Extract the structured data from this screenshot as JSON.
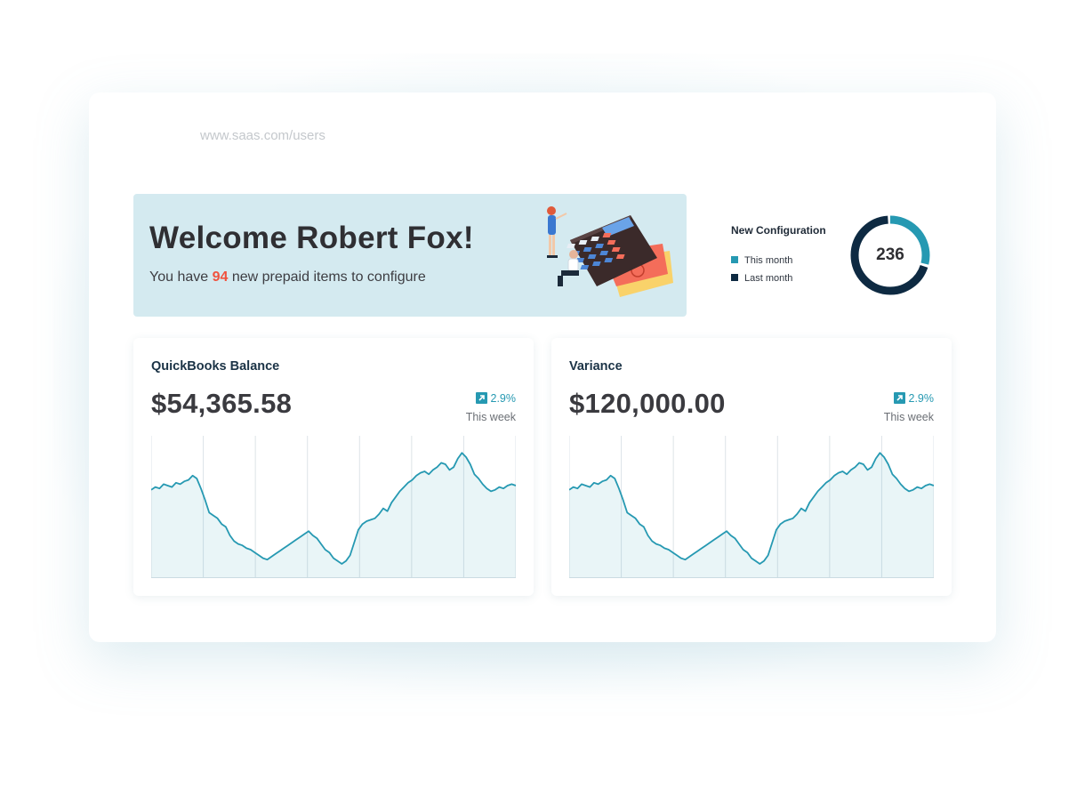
{
  "url_bar": {
    "url": "www.saas.com/users"
  },
  "welcome": {
    "title": "Welcome Robert Fox!",
    "sub_prefix": "You have ",
    "count": "94",
    "sub_suffix": " new prepaid items to configure"
  },
  "new_configuration": {
    "title": "New Configuration",
    "legend": [
      {
        "label": "This month",
        "color": "#2699b2"
      },
      {
        "label": "Last month",
        "color": "#0e2a42"
      }
    ],
    "value": "236",
    "this_month_fraction": 0.3
  },
  "cards": [
    {
      "title": "QuickBooks Balance",
      "value": "$54,365.58",
      "change": "2.9%",
      "period": "This week",
      "icon": "arrow-up-right-icon"
    },
    {
      "title": "Variance",
      "value": "$120,000.00",
      "change": "2.9%",
      "period": "This week",
      "icon": "arrow-up-right-icon"
    }
  ],
  "colors": {
    "accent": "#2699b2",
    "dark": "#0e2a42",
    "highlight": "#f0523e",
    "banner_bg": "#d4eaf0"
  },
  "chart_data": [
    {
      "type": "area",
      "title": "",
      "xlabel": "",
      "ylabel": "",
      "grid": true,
      "series": [
        {
          "values": [
            62,
            64,
            63,
            66,
            65,
            64,
            67,
            66,
            68,
            69,
            72,
            70,
            63,
            55,
            46,
            44,
            42,
            38,
            36,
            30,
            26,
            24,
            23,
            21,
            20,
            18,
            16,
            14,
            13,
            15,
            17,
            19,
            21,
            23,
            25,
            27,
            29,
            31,
            33,
            30,
            28,
            24,
            20,
            18,
            14,
            12,
            10,
            12,
            16,
            25,
            34,
            38,
            40,
            41,
            42,
            45,
            49,
            47,
            53,
            57,
            61,
            64,
            67,
            69,
            72,
            74,
            75,
            73,
            76,
            78,
            81,
            80,
            76,
            78,
            84,
            88,
            85,
            80,
            73,
            70,
            66,
            63,
            61,
            62,
            64,
            63,
            65,
            66,
            65
          ]
        }
      ],
      "ylim": [
        0,
        100
      ]
    },
    {
      "type": "area",
      "title": "",
      "xlabel": "",
      "ylabel": "",
      "grid": true,
      "series": [
        {
          "values": [
            62,
            64,
            63,
            66,
            65,
            64,
            67,
            66,
            68,
            69,
            72,
            70,
            63,
            55,
            46,
            44,
            42,
            38,
            36,
            30,
            26,
            24,
            23,
            21,
            20,
            18,
            16,
            14,
            13,
            15,
            17,
            19,
            21,
            23,
            25,
            27,
            29,
            31,
            33,
            30,
            28,
            24,
            20,
            18,
            14,
            12,
            10,
            12,
            16,
            25,
            34,
            38,
            40,
            41,
            42,
            45,
            49,
            47,
            53,
            57,
            61,
            64,
            67,
            69,
            72,
            74,
            75,
            73,
            76,
            78,
            81,
            80,
            76,
            78,
            84,
            88,
            85,
            80,
            73,
            70,
            66,
            63,
            61,
            62,
            64,
            63,
            65,
            66,
            65
          ]
        }
      ],
      "ylim": [
        0,
        100
      ]
    }
  ]
}
